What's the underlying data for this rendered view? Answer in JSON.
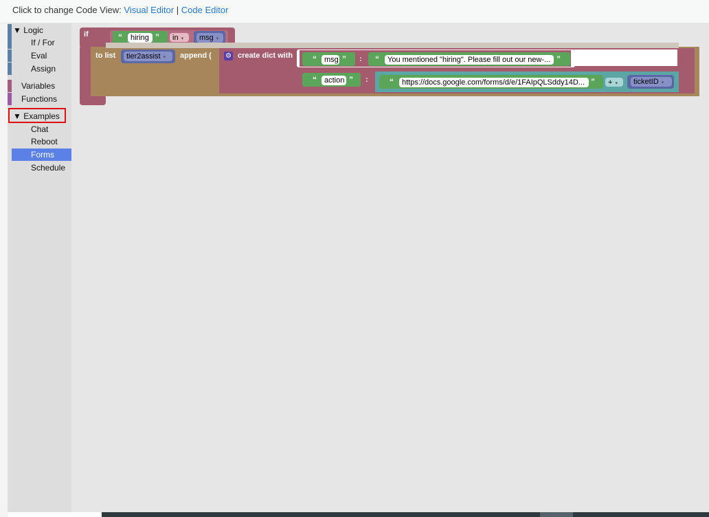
{
  "header": {
    "prefix": "Click to change Code View:",
    "visual_editor": "Visual Editor",
    "separator": "|",
    "code_editor": "Code Editor"
  },
  "toolbox": {
    "logic": "▼ Logic",
    "if_for": "If / For",
    "eval": "Eval",
    "assign": "Assign",
    "variables": "Variables",
    "functions": "Functions",
    "examples": "▼ Examples",
    "chat": "Chat",
    "reboot": "Reboot",
    "forms": "Forms",
    "schedule": "Schedule"
  },
  "blocks": {
    "if_label": "if",
    "cond_text": "hiring",
    "cond_op": "in",
    "cond_var": "msg",
    "to_list_label": "to list",
    "list_var": "tier2assist",
    "append_label": "append (",
    "close_paren": ")",
    "create_dict_label": "create dict with",
    "key1": "msg",
    "colon": ":",
    "value1": "You mentioned \"hiring\". Please fill out our new-...",
    "key2": "action",
    "value2_url": "https://docs.google.com/forms/d/e/1FAIpQLSddy14D...",
    "plus_op": "+",
    "value2_var": "ticketID",
    "open_quote": "“",
    "close_quote": "”"
  },
  "colors": {
    "logic": "#5b80a5",
    "variables": "#a55b80",
    "functions": "#9a5ba5",
    "selected": "#5b80e6",
    "highlight": "#e01010",
    "link": "#2a78c7"
  }
}
